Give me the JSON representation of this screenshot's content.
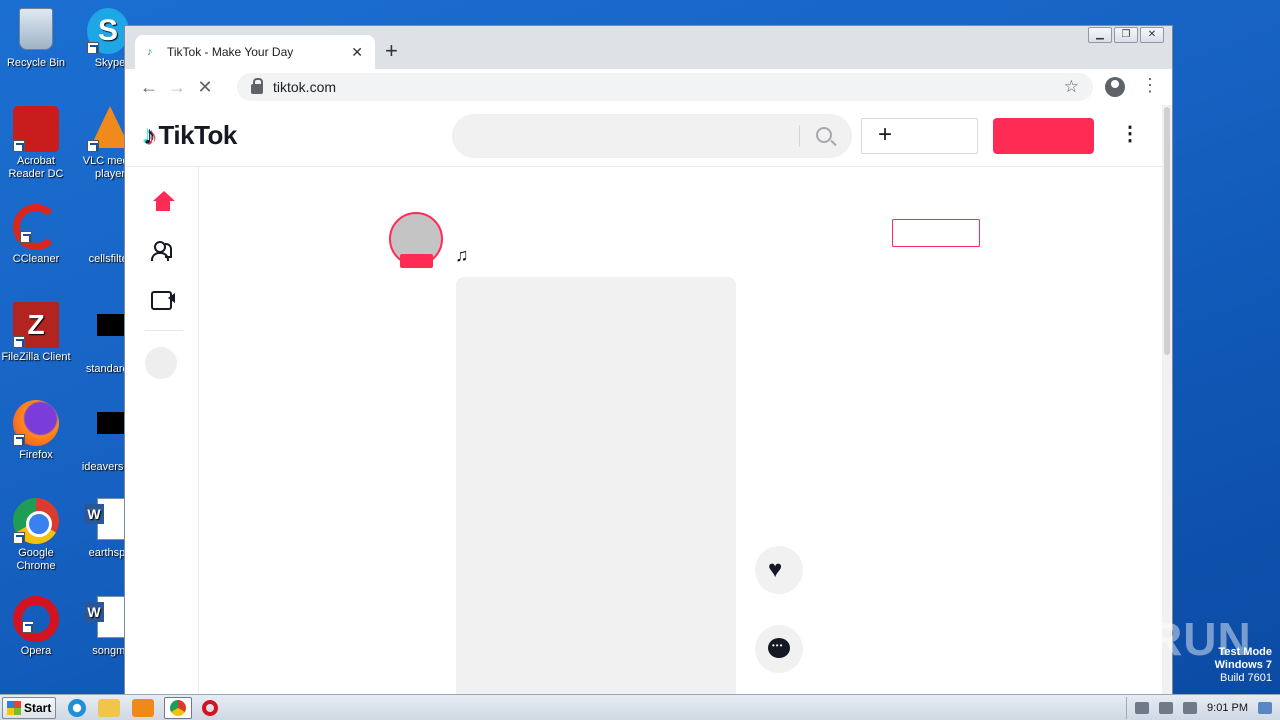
{
  "desktop": {
    "icons": [
      {
        "label": "Recycle Bin"
      },
      {
        "label": "Skype"
      },
      {
        "label": "Acrobat Reader DC"
      },
      {
        "label": "VLC media player"
      },
      {
        "label": "CCleaner"
      },
      {
        "label": "cellsfilter"
      },
      {
        "label": "FileZilla Client"
      },
      {
        "label": "standards"
      },
      {
        "label": "Firefox"
      },
      {
        "label": "ideaversion"
      },
      {
        "label": "Google Chrome"
      },
      {
        "label": "earthspa"
      },
      {
        "label": "Opera"
      },
      {
        "label": "songmi"
      }
    ]
  },
  "browser": {
    "tab_title": "TikTok - Make Your Day",
    "url": "tiktok.com"
  },
  "tiktok": {
    "logo_text": "TikTok"
  },
  "taskbar": {
    "start_label": "Start",
    "clock": "9:01 PM"
  },
  "watermark": {
    "line1": "Test Mode",
    "line2": "Windows 7",
    "line3": "Build 7601",
    "brand": "ANY RUN"
  }
}
